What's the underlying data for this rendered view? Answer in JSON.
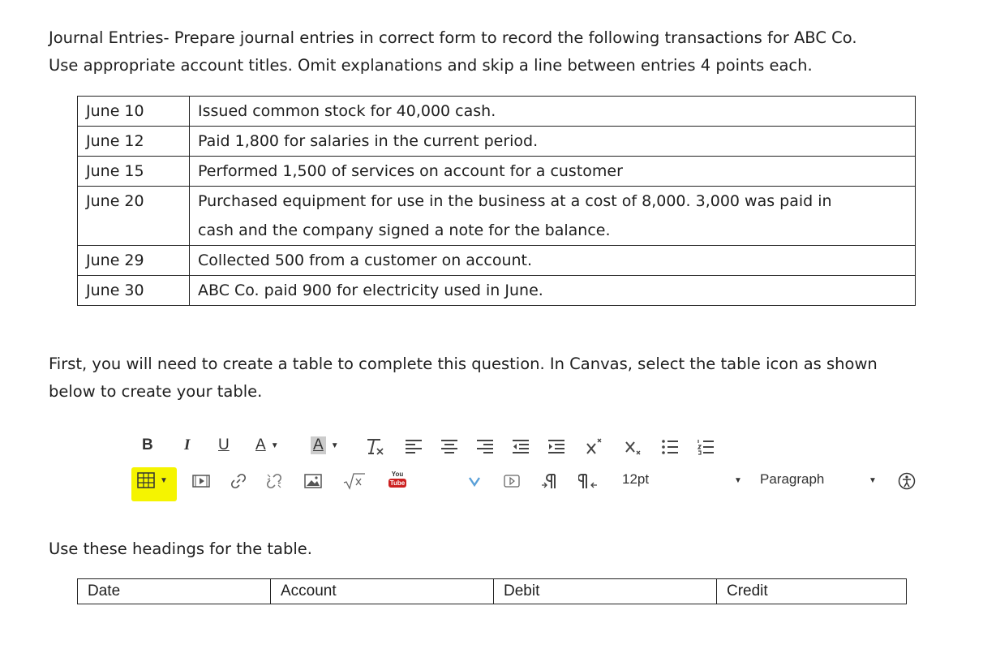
{
  "intro": {
    "line1": "Journal Entries- Prepare journal entries in correct form to record the following transactions for ABC Co.",
    "line2": "Use appropriate account titles. Omit explanations and skip a line between entries 4 points each."
  },
  "transactions": [
    {
      "date": "June 10",
      "line1": "Issued common stock for 40,000 cash.",
      "line2": ""
    },
    {
      "date": "June 12",
      "line1": "Paid 1,800 for salaries in the current period.",
      "line2": ""
    },
    {
      "date": "June 15",
      "line1": "Performed 1,500 of services on account for a customer",
      "line2": ""
    },
    {
      "date": "June 20",
      "line1": "Purchased equipment for use in the business at a cost of 8,000. 3,000 was paid in",
      "line2": "cash and the company signed a note for the balance."
    },
    {
      "date": "June 29",
      "line1": "Collected 500 from a customer on account.",
      "line2": ""
    },
    {
      "date": "June 30",
      "line1": "ABC Co. paid 900 for electricity used in June.",
      "line2": ""
    }
  ],
  "instruction": {
    "line1": "First, you will need to create a table to complete this question. In Canvas, select the table icon as shown",
    "line2": "below to create your table."
  },
  "toolbar": {
    "bold": "B",
    "italic": "I",
    "underline": "U",
    "font_color": "A",
    "background_color": "A",
    "font_size": "12pt",
    "format": "Paragraph",
    "youtube_line1": "You",
    "youtube_line2": "Tube",
    "highlight_color": "#f5f400"
  },
  "headings_intro": "Use these headings for the table.",
  "headings": [
    "Date",
    "Account",
    "Debit",
    "Credit"
  ]
}
